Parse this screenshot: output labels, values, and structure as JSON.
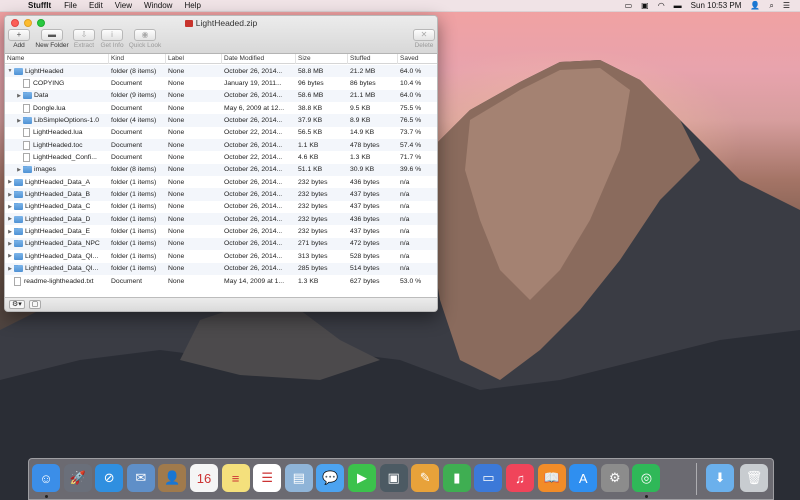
{
  "menubar": {
    "apple": "",
    "app": "StuffIt",
    "items": [
      "File",
      "Edit",
      "View",
      "Window",
      "Help"
    ],
    "clock": "Sun 10:53 PM"
  },
  "window": {
    "title": "LightHeaded.zip",
    "toolbar": [
      {
        "label": "Add",
        "glyph": "+",
        "enabled": true
      },
      {
        "label": "New Folder",
        "glyph": "▬",
        "enabled": true
      },
      {
        "label": "Extract",
        "glyph": "⇩",
        "enabled": false
      },
      {
        "label": "Get Info",
        "glyph": "i",
        "enabled": false
      },
      {
        "label": "Quick Look",
        "glyph": "◉",
        "enabled": false
      },
      {
        "label": "Delete",
        "glyph": "✕",
        "enabled": false
      }
    ],
    "columns": [
      "Name",
      "Kind",
      "Label",
      "Date Modified",
      "Size",
      "Stuffed",
      "Saved"
    ],
    "rows": [
      {
        "name": "LightHeaded",
        "kind": "folder (8 items)",
        "label": "None",
        "date": "October 26, 2014...",
        "size": "58.8 MB",
        "stuffed": "21.2 MB",
        "saved": "64.0 %",
        "type": "folder",
        "level": 0,
        "disclosure": "open"
      },
      {
        "name": "COPYING",
        "kind": "Document",
        "label": "None",
        "date": "January 19, 2011...",
        "size": "96 bytes",
        "stuffed": "86 bytes",
        "saved": "10.4 %",
        "type": "doc",
        "level": 1,
        "disclosure": ""
      },
      {
        "name": "Data",
        "kind": "folder (9 items)",
        "label": "None",
        "date": "October 26, 2014...",
        "size": "58.6 MB",
        "stuffed": "21.1 MB",
        "saved": "64.0 %",
        "type": "folder",
        "level": 1,
        "disclosure": "closed"
      },
      {
        "name": "Dongle.lua",
        "kind": "Document",
        "label": "None",
        "date": "May 6, 2009 at 12...",
        "size": "38.8 KB",
        "stuffed": "9.5 KB",
        "saved": "75.5 %",
        "type": "doc",
        "level": 1,
        "disclosure": ""
      },
      {
        "name": "LibSimpleOptions-1.0",
        "kind": "folder (4 items)",
        "label": "None",
        "date": "October 26, 2014...",
        "size": "37.9 KB",
        "stuffed": "8.9 KB",
        "saved": "76.5 %",
        "type": "folder",
        "level": 1,
        "disclosure": "closed"
      },
      {
        "name": "LightHeaded.lua",
        "kind": "Document",
        "label": "None",
        "date": "October 22, 2014...",
        "size": "56.5 KB",
        "stuffed": "14.9 KB",
        "saved": "73.7 %",
        "type": "doc",
        "level": 1,
        "disclosure": ""
      },
      {
        "name": "LightHeaded.toc",
        "kind": "Document",
        "label": "None",
        "date": "October 26, 2014...",
        "size": "1.1 KB",
        "stuffed": "478 bytes",
        "saved": "57.4 %",
        "type": "doc",
        "level": 1,
        "disclosure": ""
      },
      {
        "name": "LightHeaded_Confi...",
        "kind": "Document",
        "label": "None",
        "date": "October 22, 2014...",
        "size": "4.6 KB",
        "stuffed": "1.3 KB",
        "saved": "71.7 %",
        "type": "doc",
        "level": 1,
        "disclosure": ""
      },
      {
        "name": "images",
        "kind": "folder (8 items)",
        "label": "None",
        "date": "October 26, 2014...",
        "size": "51.1 KB",
        "stuffed": "30.9 KB",
        "saved": "39.6 %",
        "type": "folder",
        "level": 1,
        "disclosure": "closed"
      },
      {
        "name": "LightHeaded_Data_A",
        "kind": "folder (1 items)",
        "label": "None",
        "date": "October 26, 2014...",
        "size": "232 bytes",
        "stuffed": "436 bytes",
        "saved": "n/a",
        "type": "folder",
        "level": 0,
        "disclosure": "closed"
      },
      {
        "name": "LightHeaded_Data_B",
        "kind": "folder (1 items)",
        "label": "None",
        "date": "October 26, 2014...",
        "size": "232 bytes",
        "stuffed": "437 bytes",
        "saved": "n/a",
        "type": "folder",
        "level": 0,
        "disclosure": "closed"
      },
      {
        "name": "LightHeaded_Data_C",
        "kind": "folder (1 items)",
        "label": "None",
        "date": "October 26, 2014...",
        "size": "232 bytes",
        "stuffed": "437 bytes",
        "saved": "n/a",
        "type": "folder",
        "level": 0,
        "disclosure": "closed"
      },
      {
        "name": "LightHeaded_Data_D",
        "kind": "folder (1 items)",
        "label": "None",
        "date": "October 26, 2014...",
        "size": "232 bytes",
        "stuffed": "436 bytes",
        "saved": "n/a",
        "type": "folder",
        "level": 0,
        "disclosure": "closed"
      },
      {
        "name": "LightHeaded_Data_E",
        "kind": "folder (1 items)",
        "label": "None",
        "date": "October 26, 2014...",
        "size": "232 bytes",
        "stuffed": "437 bytes",
        "saved": "n/a",
        "type": "folder",
        "level": 0,
        "disclosure": "closed"
      },
      {
        "name": "LightHeaded_Data_NPC",
        "kind": "folder (1 items)",
        "label": "None",
        "date": "October 26, 2014...",
        "size": "271 bytes",
        "stuffed": "472 bytes",
        "saved": "n/a",
        "type": "folder",
        "level": 0,
        "disclosure": "closed"
      },
      {
        "name": "LightHeaded_Data_QI...",
        "kind": "folder (1 items)",
        "label": "None",
        "date": "October 26, 2014...",
        "size": "313 bytes",
        "stuffed": "528 bytes",
        "saved": "n/a",
        "type": "folder",
        "level": 0,
        "disclosure": "closed"
      },
      {
        "name": "LightHeaded_Data_QI...",
        "kind": "folder (1 items)",
        "label": "None",
        "date": "October 26, 2014...",
        "size": "285 bytes",
        "stuffed": "514 bytes",
        "saved": "n/a",
        "type": "folder",
        "level": 0,
        "disclosure": "closed"
      },
      {
        "name": "readme-lightheaded.txt",
        "kind": "Document",
        "label": "None",
        "date": "May 14, 2009 at 1...",
        "size": "1.3 KB",
        "stuffed": "627 bytes",
        "saved": "53.0 %",
        "type": "doc",
        "level": 0,
        "disclosure": ""
      }
    ],
    "status": {
      "gear": "⚙▾",
      "view": "▢"
    }
  },
  "dock": {
    "apps": [
      {
        "name": "finder-icon",
        "color": "#3b8ee8",
        "glyph": "☺",
        "running": true
      },
      {
        "name": "launchpad-icon",
        "color": "#6a6f7a",
        "glyph": "🚀",
        "running": false
      },
      {
        "name": "safari-icon",
        "color": "#2f8fe0",
        "glyph": "⊘",
        "running": false
      },
      {
        "name": "mail-stamp-icon",
        "color": "#5f8fc8",
        "glyph": "✉",
        "running": false
      },
      {
        "name": "contacts-icon",
        "color": "#a07a4c",
        "glyph": "👤",
        "running": false
      },
      {
        "name": "calendar-icon",
        "color": "#f5f5f5",
        "glyph": "16",
        "running": false
      },
      {
        "name": "notes-icon",
        "color": "#f4e07c",
        "glyph": "≡",
        "running": false
      },
      {
        "name": "reminders-icon",
        "color": "#ffffff",
        "glyph": "☰",
        "running": false
      },
      {
        "name": "preview-icon",
        "color": "#8fb4d8",
        "glyph": "▤",
        "running": false
      },
      {
        "name": "messages-icon",
        "color": "#4ca3f0",
        "glyph": "💬",
        "running": false
      },
      {
        "name": "facetime-icon",
        "color": "#3cc24c",
        "glyph": "▶",
        "running": false
      },
      {
        "name": "photo-booth-icon",
        "color": "#4c5a63",
        "glyph": "▣",
        "running": false
      },
      {
        "name": "pages-icon",
        "color": "#e8a23a",
        "glyph": "✎",
        "running": false
      },
      {
        "name": "numbers-icon",
        "color": "#3fae52",
        "glyph": "▮",
        "running": false
      },
      {
        "name": "keynote-icon",
        "color": "#3c79d8",
        "glyph": "▭",
        "running": false
      },
      {
        "name": "itunes-icon",
        "color": "#f0445a",
        "glyph": "♫",
        "running": false
      },
      {
        "name": "ibooks-icon",
        "color": "#f28c28",
        "glyph": "📖",
        "running": false
      },
      {
        "name": "app-store-icon",
        "color": "#2f8ff0",
        "glyph": "A",
        "running": false
      },
      {
        "name": "system-preferences-icon",
        "color": "#8c8c8c",
        "glyph": "⚙",
        "running": false
      },
      {
        "name": "stuffit-icon",
        "color": "#2fb858",
        "glyph": "◎",
        "running": true
      }
    ],
    "others": [
      {
        "name": "downloads-folder-icon",
        "color": "#6bb0ec",
        "glyph": "⬇"
      },
      {
        "name": "trash-icon",
        "color": "#c8ccd0",
        "glyph": "🗑"
      }
    ]
  }
}
